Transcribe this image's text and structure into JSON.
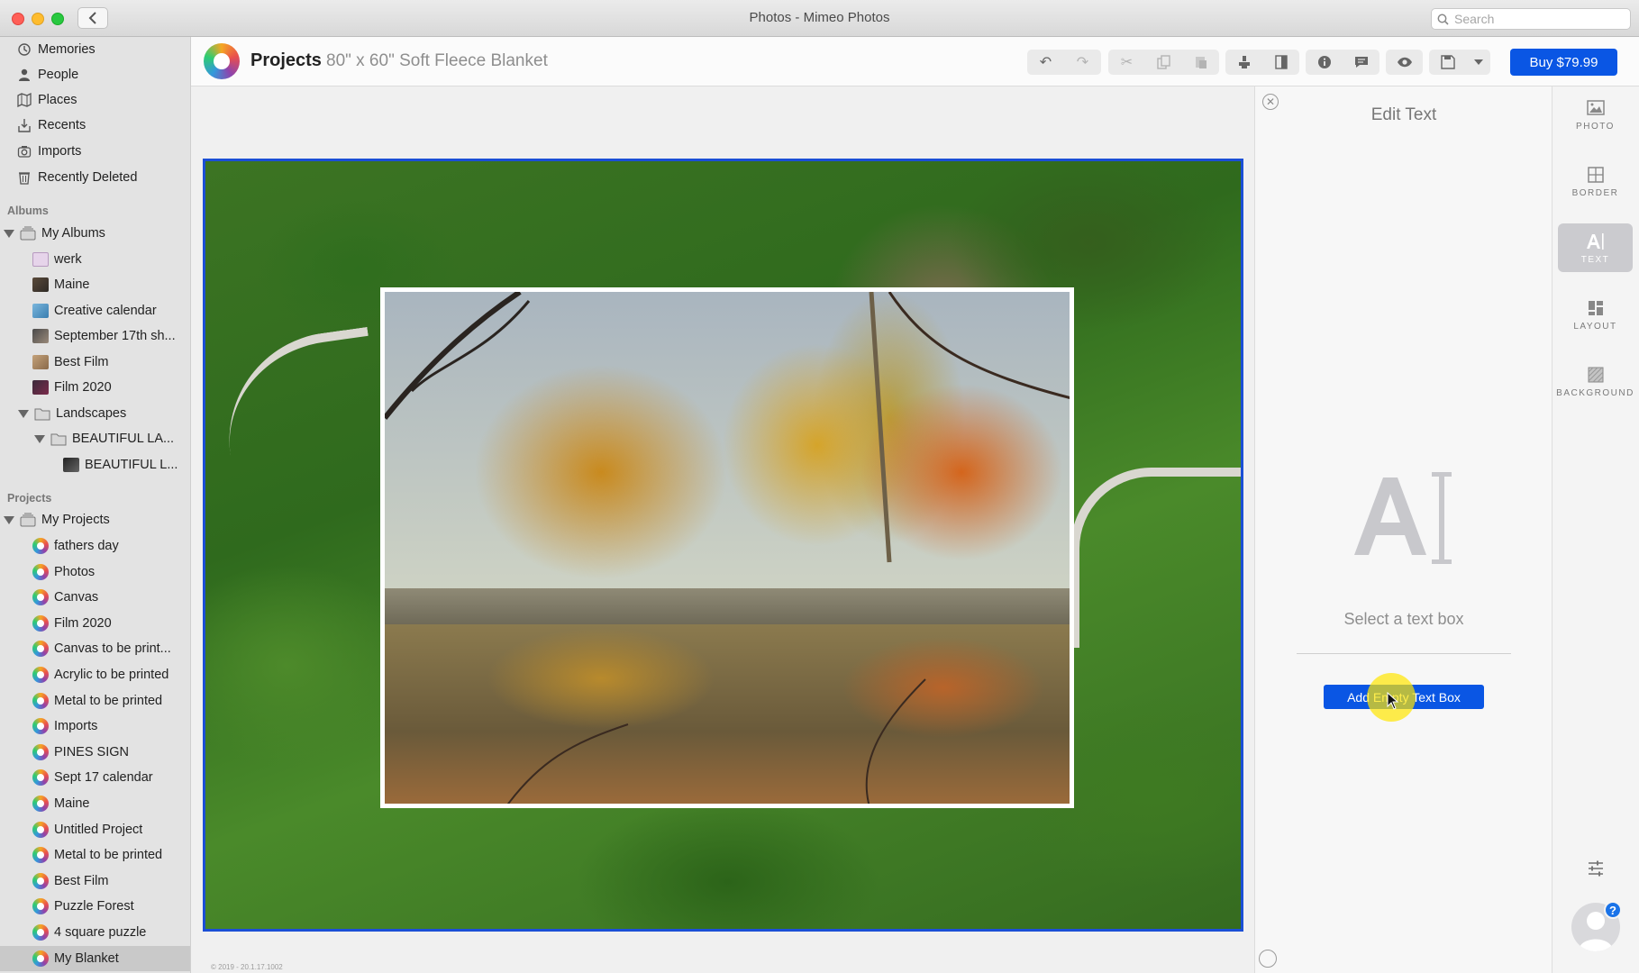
{
  "window": {
    "title": "Photos - Mimeo Photos",
    "search_placeholder": "Search"
  },
  "sidebar": {
    "library": [
      {
        "label": "Memories",
        "icon": "memories-icon"
      },
      {
        "label": "People",
        "icon": "person-icon"
      },
      {
        "label": "Places",
        "icon": "places-icon"
      },
      {
        "label": "Recents",
        "icon": "recents-icon"
      },
      {
        "label": "Imports",
        "icon": "imports-icon"
      },
      {
        "label": "Recently Deleted",
        "icon": "trash-icon"
      }
    ],
    "albums_header": "Albums",
    "my_albums": "My Albums",
    "albums": [
      {
        "label": "werk"
      },
      {
        "label": "Maine"
      },
      {
        "label": "Creative calendar"
      },
      {
        "label": "September 17th sh..."
      },
      {
        "label": "Best Film"
      },
      {
        "label": "Film 2020"
      }
    ],
    "landscapes": "Landscapes",
    "beautiful_folder": "BEAUTIFUL LA...",
    "beautiful_album": "BEAUTIFUL L...",
    "projects_header": "Projects",
    "my_projects": "My Projects",
    "projects": [
      {
        "label": "fathers day"
      },
      {
        "label": "Photos"
      },
      {
        "label": "Canvas"
      },
      {
        "label": "Film 2020"
      },
      {
        "label": "Canvas to be print..."
      },
      {
        "label": "Acrylic to be printed"
      },
      {
        "label": "Metal to be printed"
      },
      {
        "label": "Imports"
      },
      {
        "label": "PINES SIGN"
      },
      {
        "label": "Sept 17 calendar"
      },
      {
        "label": "Maine"
      },
      {
        "label": "Untitled Project"
      },
      {
        "label": "Metal to be printed"
      },
      {
        "label": "Best Film"
      },
      {
        "label": "Puzzle Forest"
      },
      {
        "label": "4 square puzzle"
      },
      {
        "label": "My Blanket",
        "selected": true
      }
    ]
  },
  "toolbar": {
    "breadcrumb_root": "Projects",
    "product_name": "80\" x 60\" Soft Fleece Blanket",
    "buy_label": "Buy $79.99",
    "accent_color": "#0a56e4"
  },
  "canvas": {
    "copyright": "© 2019 - 20.1.17.1002"
  },
  "edit_panel": {
    "title": "Edit Text",
    "hint": "Select a text box",
    "add_button": "Add Empty Text Box"
  },
  "right_rail": [
    {
      "label": "PHOTO",
      "icon": "photo-icon"
    },
    {
      "label": "BORDER",
      "icon": "border-icon"
    },
    {
      "label": "TEXT",
      "icon": "text-icon",
      "active": true
    },
    {
      "label": "LAYOUT",
      "icon": "layout-icon"
    },
    {
      "label": "BACKGROUND",
      "icon": "background-icon"
    }
  ],
  "help": {
    "badge": "?"
  }
}
